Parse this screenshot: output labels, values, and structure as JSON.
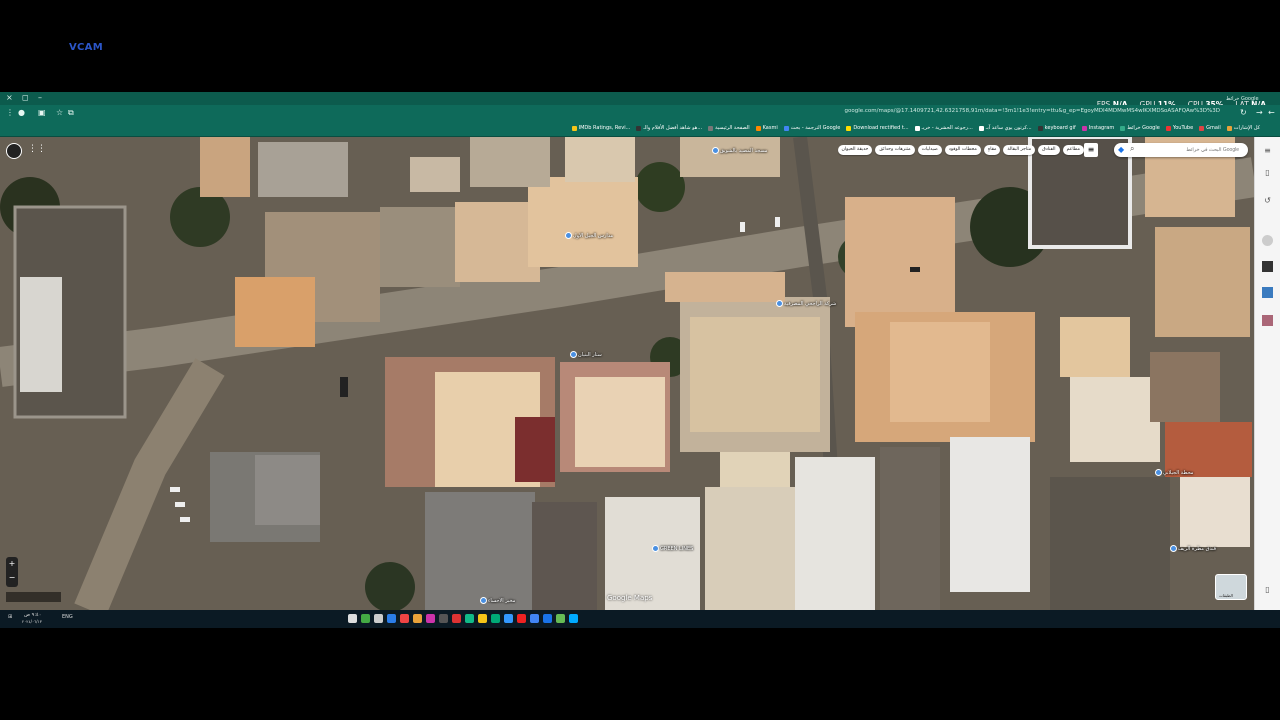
{
  "overlay": {
    "watermark": "VCAM"
  },
  "window_controls": {
    "close": "×",
    "maximize": "◻",
    "minimize": "–"
  },
  "stats": [
    {
      "name": "FPS",
      "value": "N/A"
    },
    {
      "name": "GPU",
      "value": "11%"
    },
    {
      "name": "CPU",
      "value": "35%"
    },
    {
      "name": "LAT",
      "value": "N/A"
    }
  ],
  "tab": {
    "title": "خرائط Google"
  },
  "browser": {
    "url": "google.com/maps/@17.1409721,42.6321758,91m/data=!3m1!1e3!entry=ttu&g_ep=EgoyMDI4MDMwMS4wIKXMDSoASAFQAw%3D%3D"
  },
  "bookmarks": [
    "كل الإشارات",
    "Gmail",
    "YouTube",
    "خرائط Google",
    "Instagram",
    "keyboard gif",
    "كرتون يوي ساعد آبـ...",
    "رجوعه الحشرية - خريـ...",
    "Download rectified t...",
    "الترجمة - بحث Google",
    "Kasmi",
    "الصفحة الرئيسية",
    "هو شاهد أفضل الأفلام والـ...",
    "IMDb Ratings, Revi..."
  ],
  "map": {
    "search_placeholder": "البحث في خرائط Google",
    "chips": [
      "مطاعم",
      "الفنادق",
      "متاجر البقالة",
      "مقاهٍ",
      "محطات الوقود",
      "صيدليات",
      "متنزهات وحدائق",
      "حديقة الحيوان"
    ],
    "labels": [
      {
        "text": "مسجد المصيد بالشويق"
      },
      {
        "text": "مدارس الجيل الاول"
      },
      {
        "text": "شركة الراجحي المصرفية"
      },
      {
        "text": "محطة الجيلاني"
      },
      {
        "text": "GREEN LINES"
      },
      {
        "text": "ستار البنيان"
      },
      {
        "text": "مخبز الاحساء"
      },
      {
        "text": "فندق مطرة الريف"
      }
    ],
    "logo": "Google Maps",
    "layers_label": "الطبقات"
  },
  "taskbar": {
    "lang": "ENG",
    "time": "٩:٤٠ ص",
    "date": "٢٠٢٤/٠٦/١٣"
  },
  "colors": {
    "chrome_green": "#0e6a5a",
    "watermark_blue": "#2b56c9",
    "taskbar": "#0b1a24"
  }
}
